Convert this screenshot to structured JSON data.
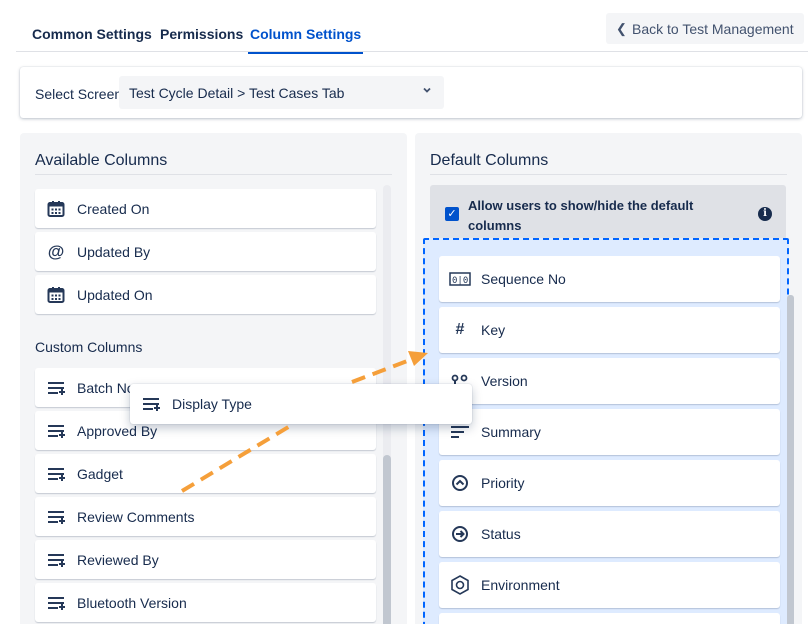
{
  "tabs": [
    {
      "label": "Common Settings"
    },
    {
      "label": "Permissions"
    },
    {
      "label": "Column Settings"
    }
  ],
  "back_button": {
    "label": "Back to Test Management"
  },
  "select_screen": {
    "label": "Select Screen",
    "value": "Test Cycle Detail > Test Cases Tab"
  },
  "available": {
    "title": "Available Columns",
    "items": [
      {
        "label": "Created On",
        "icon": "calendar-icon"
      },
      {
        "label": "Updated By",
        "icon": "at-icon"
      },
      {
        "label": "Updated On",
        "icon": "calendar-icon"
      }
    ],
    "custom_label": "Custom Columns",
    "custom_items": [
      {
        "label": "Batch No",
        "icon": "list-add-icon"
      },
      {
        "label": "Approved By",
        "icon": "list-add-icon"
      },
      {
        "label": "Gadget",
        "icon": "list-add-icon"
      },
      {
        "label": "Review Comments",
        "icon": "list-add-icon"
      },
      {
        "label": "Reviewed By",
        "icon": "list-add-icon"
      },
      {
        "label": "Bluetooth Version",
        "icon": "list-add-icon"
      }
    ]
  },
  "dragging": {
    "label": "Display Type",
    "icon": "list-add-icon"
  },
  "default": {
    "title": "Default Columns",
    "allow_text": "Allow users to show/hide the default columns",
    "allow_checked": true,
    "items": [
      {
        "label": "Sequence No",
        "icon": "sequence-icon"
      },
      {
        "label": "Key",
        "icon": "hash-icon"
      },
      {
        "label": "Version",
        "icon": "version-icon"
      },
      {
        "label": "Summary",
        "icon": "summary-icon"
      },
      {
        "label": "Priority",
        "icon": "priority-icon"
      },
      {
        "label": "Status",
        "icon": "status-icon"
      },
      {
        "label": "Environment",
        "icon": "environment-icon"
      }
    ]
  },
  "colors": {
    "accent": "#0052cc",
    "drag_arrow": "#f59f3a",
    "drop_zone": "#deebff"
  }
}
